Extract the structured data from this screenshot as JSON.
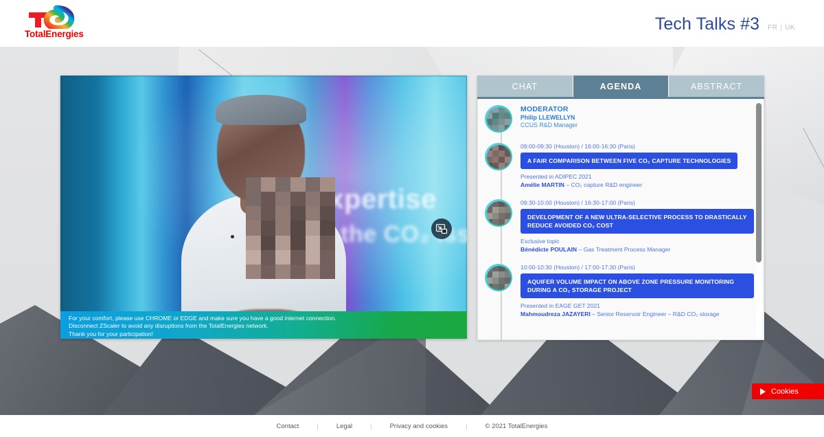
{
  "header": {
    "logo_word": "TotalEnergies",
    "logo_icon": "totalenergies-logo",
    "event_title": "Tech Talks #3",
    "lang_fr": "FR",
    "lang_sep": "|",
    "lang_uk": "UK"
  },
  "video": {
    "background_text_line1": "r expertise",
    "background_text_line2": "ckle the CO₂ issue",
    "pip_icon": "picture-in-picture-icon"
  },
  "notice": {
    "line1": "For your comfort, please use CHROME or EDGE and make sure you have a good internet connection.",
    "line2": "Disconnect ZScaler to avoid any disruptions from the TotalEnergies network.",
    "line3": "Thank you for your participation!"
  },
  "panel": {
    "tabs": [
      {
        "label": "CHAT",
        "active": false
      },
      {
        "label": "AGENDA",
        "active": true
      },
      {
        "label": "ABSTRACT",
        "active": false
      }
    ],
    "moderator": {
      "role_label": "MODERATOR",
      "name": "Philip LLEWELLYN",
      "title": "CCUS R&D Manager"
    },
    "sessions": [
      {
        "time": "09:00-09:30 (Houston) / 16:00-16:30 (Paris)",
        "title": "A FAIR COMPARISON BETWEEN FIVE CO₂ CAPTURE TECHNOLOGIES",
        "context": "Presented in ADIPEC 2021",
        "speaker": "Amélie MARTIN",
        "speaker_role": " – CO₂ capture R&D engineer"
      },
      {
        "time": "09:30-10:00 (Houston) / 16:30-17:00 (Paris)",
        "title": "DEVELOPMENT OF A NEW ULTRA-SELECTIVE PROCESS TO DRASTICALLY REDUCE AVOIDED CO₂ COST",
        "context": "Exclusive topic",
        "speaker": "Bénédicte POULAIN",
        "speaker_role": " – Gas Treatment Process Manager"
      },
      {
        "time": "10:00-10:30 (Houston) / 17:00-17:30 (Paris)",
        "title": "AQUIFER VOLUME IMPACT ON ABOVE ZONE PRESSURE MONITORING DURING A CO₂ STORAGE PROJECT",
        "context": "Presented in EAGE GET 2021",
        "speaker": "Mahmoudreza JAZAYERI",
        "speaker_role": " – Senior Reservoir Engineer – R&D CO₂ storage"
      }
    ]
  },
  "cookies": {
    "label": "Cookies",
    "icon": "play-triangle-icon"
  },
  "footer": {
    "links": [
      "Contact",
      "Legal",
      "Privacy and cookies"
    ],
    "separator": "|",
    "copyright": "© 2021 TotalEnergies"
  },
  "colors": {
    "brand_red": "#ED0000",
    "title_blue": "#2D4A9A",
    "talk_blue": "#2B4FE0",
    "tab_active": "#5E8095",
    "tab_inactive": "#B0C4CE",
    "cookies_red": "#F00000",
    "notice_gradient_start": "#0B9EE0",
    "notice_gradient_end": "#1AA83F"
  }
}
